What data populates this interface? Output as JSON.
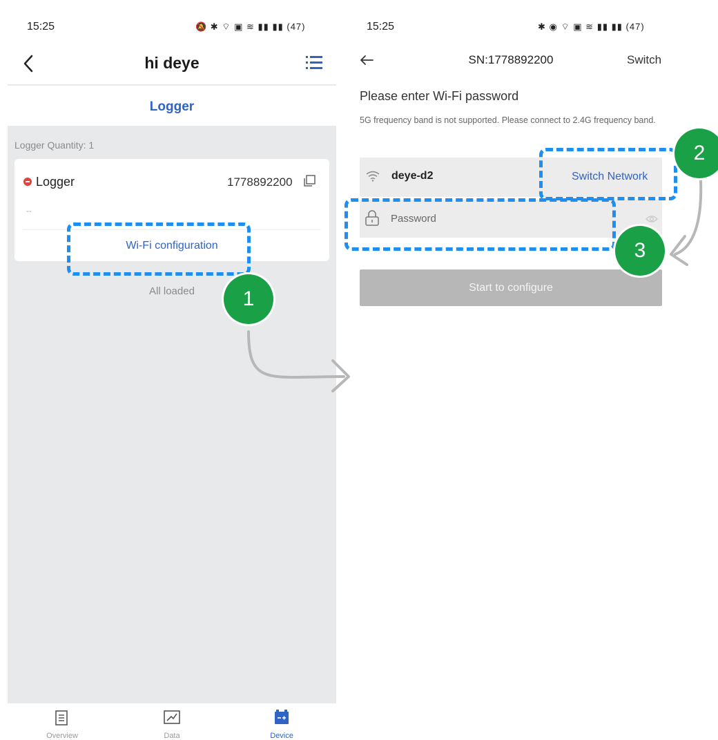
{
  "left": {
    "status": {
      "time": "15:25",
      "icons": "🔕 ✱ ⌔ ▣ ≋ ▮▮ ▮▮ (47)"
    },
    "header": {
      "title": "hi deye"
    },
    "tab": "Logger",
    "logger_quantity": "Logger Quantity: 1",
    "card": {
      "name": "Logger",
      "serial": "1778892200",
      "sub": "--",
      "wifi_config": "Wi-Fi configuration"
    },
    "all_loaded": "All loaded",
    "nav": [
      {
        "label": "Overview",
        "icon": "document-icon"
      },
      {
        "label": "Data",
        "icon": "chart-icon"
      },
      {
        "label": "Device",
        "icon": "battery-icon",
        "active": true
      }
    ]
  },
  "right": {
    "status": {
      "time": "15:25",
      "icons": "✱ ◉ ⌔ ▣ ≋ ▮▮ ▮▮ (47)"
    },
    "header": {
      "title": "SN:1778892200",
      "switch": "Switch"
    },
    "prompt": "Please enter Wi-Fi password",
    "note": "5G frequency band is not supported. Please connect to 2.4G frequency band.",
    "ssid": "deye-d2",
    "switch_network": "Switch Network",
    "password_placeholder": "Password",
    "start_button": "Start to configure"
  },
  "annotations": {
    "badge1": "1",
    "badge2": "2",
    "badge3": "3"
  },
  "colors": {
    "accent": "#2f63c4",
    "badge": "#1aa046",
    "highlight": "#1e8ff0",
    "error": "#e0443e"
  }
}
